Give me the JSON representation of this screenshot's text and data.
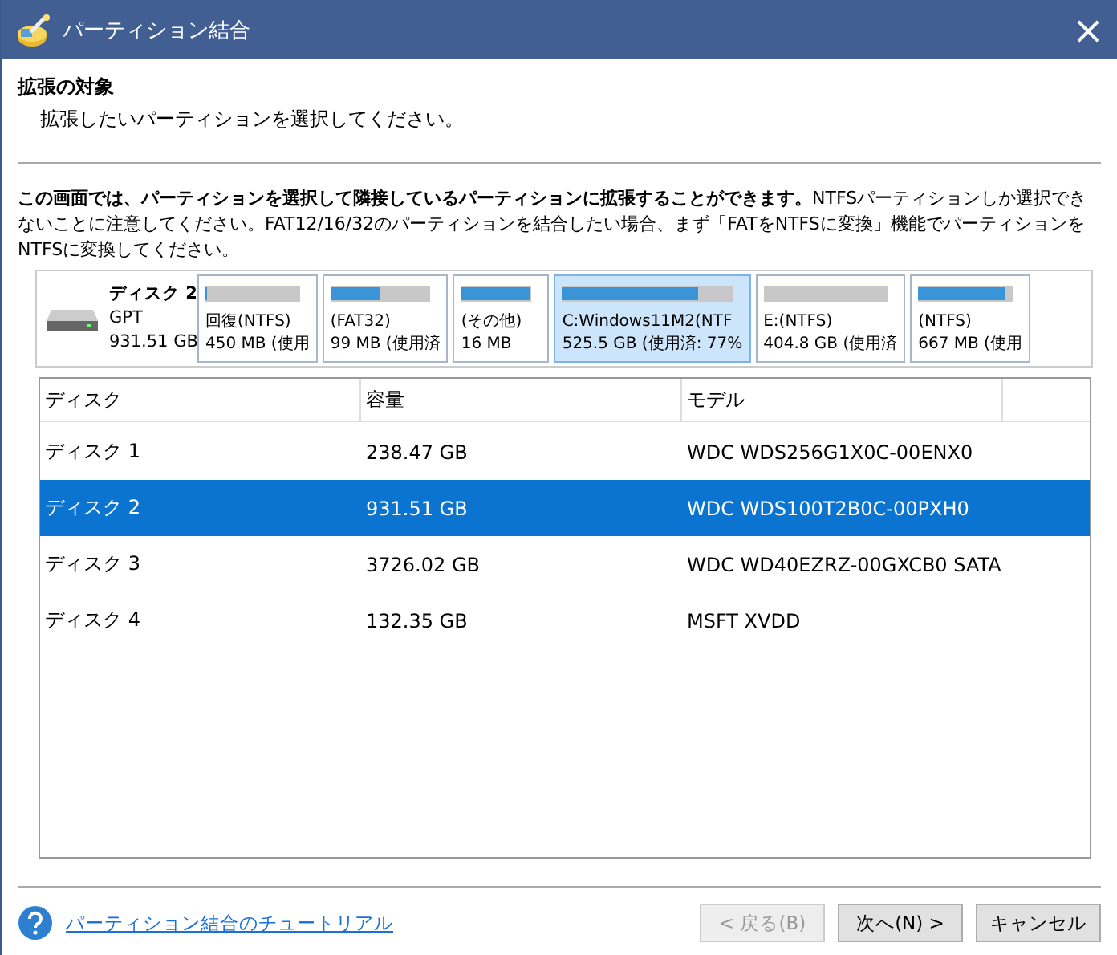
{
  "window": {
    "title": "パーティション結合",
    "close": "×"
  },
  "header": {
    "title": "拡張の対象",
    "subtitle": "拡張したいパーティションを選択してください。"
  },
  "instruction": "**この画面では、パーティションを選択して隣接しているパーティションに拡張することができます。**NTFSパーティションしか選択できないことに注意してください。FAT12/16/32のパーティションを結合したい場合、まず「FATをNTFSに変換」機能でパーティションをNTFSに変換してください。",
  "disk_map": {
    "name": "ディスク 2",
    "type": "GPT",
    "size": "931.51 GB",
    "partitions": [
      {
        "label": "回復(NTFS)",
        "info": "450 MB (使用",
        "level": 0.02,
        "selected": false
      },
      {
        "label": "(FAT32)",
        "info": "99 MB (使用済",
        "level": 0.5,
        "selected": false
      },
      {
        "label": "(その他)",
        "info": "16 MB",
        "level": 1,
        "selected": false
      },
      {
        "label": "C:Windows11M2(NTF",
        "info": "525.5 GB (使用済: 77%",
        "level": 0.8,
        "selected": true
      },
      {
        "label": "E:(NTFS)",
        "info": "404.8 GB (使用済",
        "level": 0,
        "selected": false
      },
      {
        "label": "(NTFS)",
        "info": "667 MB (使用",
        "level": 0.93,
        "selected": false
      }
    ]
  },
  "table": {
    "columns": [
      "ディスク",
      "容量",
      "モデル"
    ],
    "rows": [
      {
        "cells": [
          "ディスク 1",
          "238.47 GB",
          "WDC WDS256G1X0C-00ENX0"
        ],
        "selected": false
      },
      {
        "cells": [
          "ディスク 2",
          "931.51 GB",
          "WDC WDS100T2B0C-00PXH0"
        ],
        "selected": true
      },
      {
        "cells": [
          "ディスク 3",
          "3726.02 GB",
          "WDC WD40EZRZ-00GXCB0 SATA"
        ],
        "selected": false
      },
      {
        "cells": [
          "ディスク 4",
          "132.35 GB",
          "MSFT XVDD"
        ],
        "selected": false
      }
    ]
  },
  "footer": {
    "help_link": "パーティション結合のチュートリアル",
    "buttons": [
      {
        "label": "< 戻る(B)",
        "disabled": true
      },
      {
        "label": "次へ(N) >",
        "disabled": false
      },
      {
        "label": "キャンセル",
        "disabled": false
      }
    ]
  }
}
